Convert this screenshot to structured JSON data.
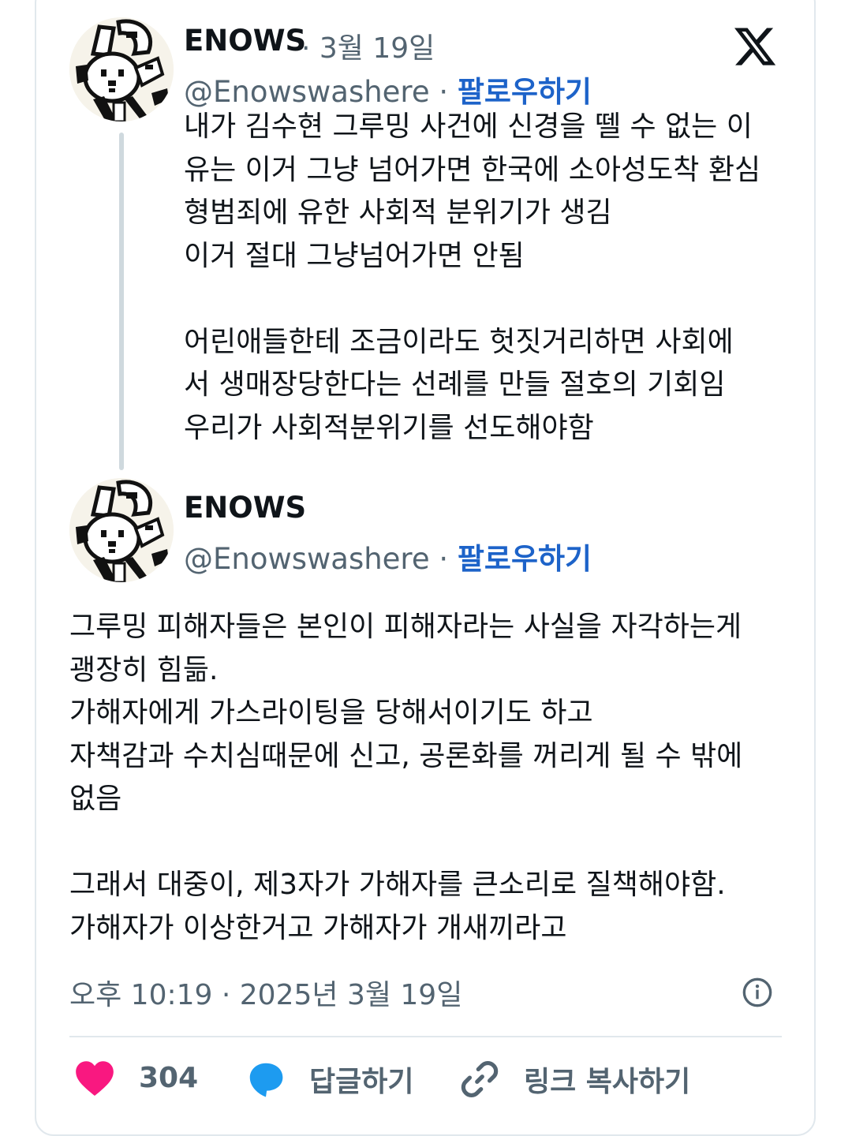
{
  "quoted_tweet": {
    "author_name": "ENOWS",
    "date": "· 3월 19일",
    "handle": "@Enowswashere",
    "separator": "·",
    "follow_label": "팔로우하기",
    "text": "내가 김수현 그루밍 사건에 신경을 뗄 수 없는 이\n유는 이거 그냥 넘어가면 한국에 소아성도착 환심\n형범죄에 유한 사회적 분위기가 생김\n이거 절대 그냥넘어가면 안됨\n\n어린애들한테 조금이라도 헛짓거리하면 사회에\n서 생매장당한다는 선례를 만들 절호의 기회임\n우리가 사회적분위기를 선도해야함"
  },
  "main_tweet": {
    "author_name": "ENOWS",
    "handle": "@Enowswashere",
    "separator": "·",
    "follow_label": "팔로우하기",
    "text": "그루밍 피해자들은 본인이 피해자라는 사실을 자각하는게\n괭장히 힘듦.\n가해자에게 가스라이팅을 당해서이기도 하고\n자책감과 수치심때문에 신고, 공론화를 꺼리게 될 수 밖에\n없음\n\n그래서 대중이, 제3자가 가해자를 큰소리로 질책해야함.\n가해자가 이상한거고 가해자가 개새끼라고",
    "timestamp": "오후 10:19 · 2025년 3월 19일"
  },
  "actions": {
    "like_count": "304",
    "reply_label": "답글하기",
    "copy_link_label": "링크 복사하기"
  },
  "icons": {
    "brand": "x-logo-icon",
    "info": "info-icon",
    "like": "heart-icon",
    "reply": "speech-bubble-icon",
    "link": "link-icon"
  },
  "colors": {
    "like": "#f91880",
    "reply": "#1d9bf0",
    "follow": "#1d63c9",
    "secondary_text": "#536471"
  }
}
